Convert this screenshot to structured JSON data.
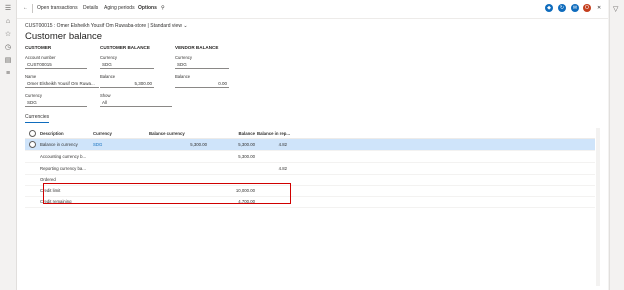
{
  "toolbar": {
    "open_transactions": "Open transactions",
    "details": "Details",
    "aging_periods": "Aging periods",
    "options": "Options"
  },
  "breadcrumb": "CUST00015 : Omer Elsheikh Yousif Om Ruwaba-store  |  Standard view",
  "page_title": "Customer balance",
  "customer": {
    "section": "CUSTOMER",
    "account_label": "Account number",
    "account_value": "CUST00015",
    "name_label": "Name",
    "name_value": "Omer Elsheikh Yousif Om Ruwa...",
    "currency_label": "Currency",
    "currency_value": "SDG"
  },
  "customer_balance": {
    "section": "CUSTOMER BALANCE",
    "currency_label": "Currency",
    "currency_value": "SDG",
    "balance_label": "Balance",
    "balance_value": "5,300.00",
    "show_label": "Show",
    "show_value": "All"
  },
  "vendor_balance": {
    "section": "VENDOR BALANCE",
    "currency_label": "Currency",
    "currency_value": "SDG",
    "balance_label": "Balance",
    "balance_value": "0.00"
  },
  "tab": "Currencies",
  "grid": {
    "headers": {
      "description": "Description",
      "currency": "Currency",
      "balance_currency": "Balance currency",
      "balance": "Balance",
      "balance_in_rep": "Balance in rep..."
    },
    "rows": [
      {
        "description": "Balance in currency",
        "currency": "SDG",
        "balance_currency": "5,300.00",
        "balance": "5,300.00",
        "balance_in_rep": "4.82"
      },
      {
        "description": "Accounting currency b...",
        "currency": "",
        "balance_currency": "",
        "balance": "5,300.00",
        "balance_in_rep": ""
      },
      {
        "description": "Reporting currency ba...",
        "currency": "",
        "balance_currency": "",
        "balance": "",
        "balance_in_rep": "4.82"
      },
      {
        "description": "Ordered",
        "currency": "",
        "balance_currency": "",
        "balance": "",
        "balance_in_rep": ""
      },
      {
        "description": "Credit limit",
        "currency": "",
        "balance_currency": "",
        "balance": "10,000.00",
        "balance_in_rep": ""
      },
      {
        "description": "Credit remaining",
        "currency": "",
        "balance_currency": "",
        "balance": "4,700.00",
        "balance_in_rep": ""
      }
    ]
  },
  "colors": {
    "accent": "#0f6cbd",
    "selected_row": "#cfe4fa",
    "highlight_box": "#d00000"
  },
  "icons": {
    "left_nav": [
      "hamburger-icon",
      "home-icon",
      "star-icon",
      "clock-icon",
      "modules-icon",
      "list-icon"
    ],
    "toolbar_right": [
      "diamond-icon",
      "refresh-icon",
      "chat-icon",
      "office-icon",
      "close-icon"
    ],
    "right_nav": "filter-icon"
  }
}
